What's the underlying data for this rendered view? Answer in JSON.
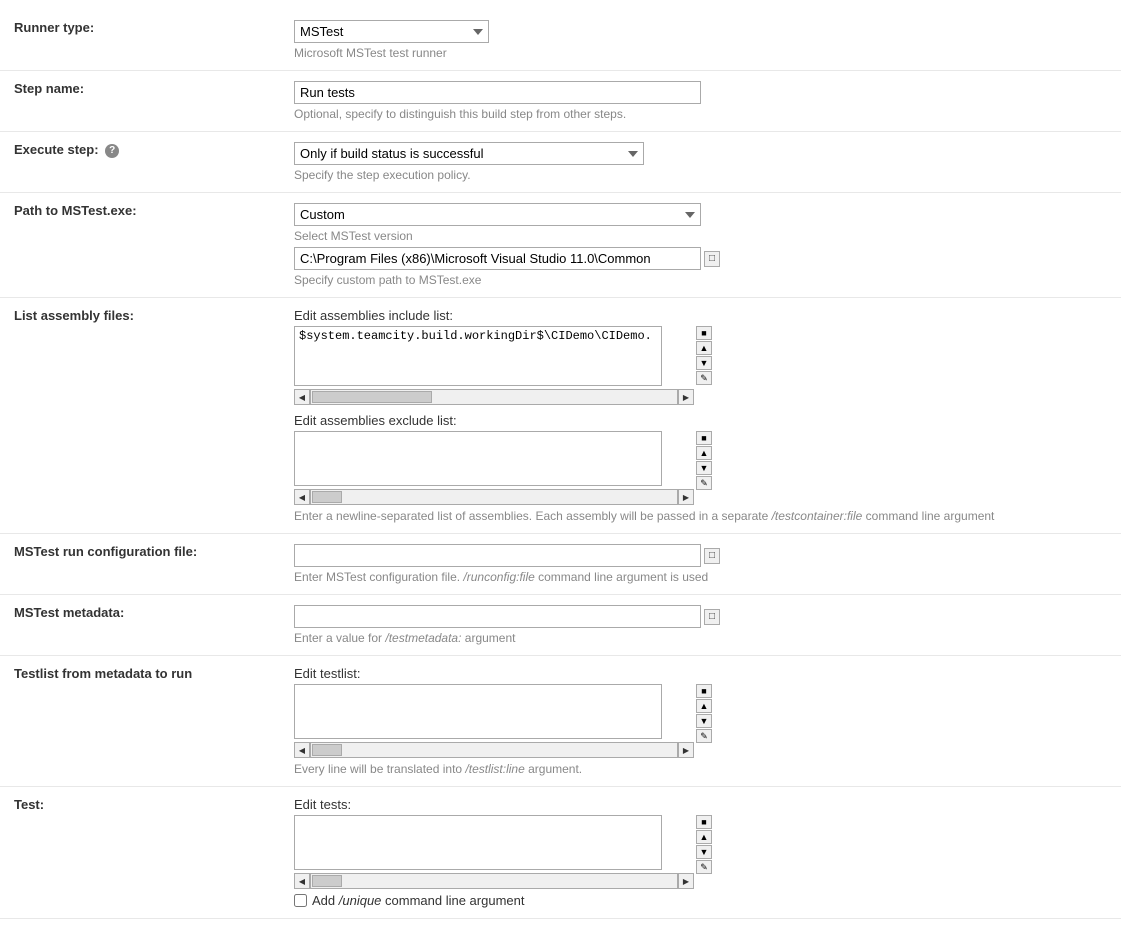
{
  "runner_type": {
    "label": "Runner type:",
    "value": "MSTest",
    "hint": "Microsoft MSTest test runner",
    "options": [
      "MSTest"
    ]
  },
  "step_name": {
    "label": "Step name:",
    "value": "Run tests",
    "hint": "Optional, specify to distinguish this build step from other steps.",
    "placeholder": ""
  },
  "execute_step": {
    "label": "Execute step:",
    "value": "Only if build status is successful",
    "hint": "Specify the step execution policy.",
    "options": [
      "Only if build status is successful"
    ]
  },
  "path_mstest": {
    "label": "Path to MSTest.exe:",
    "select_label": "Select MSTest version",
    "value": "Custom",
    "hint": "Select MSTest version",
    "custom_path_value": "C:\\Program Files (x86)\\Microsoft Visual Studio 11.0\\Common",
    "custom_path_hint": "Specify custom path to MSTest.exe",
    "options": [
      "Custom"
    ]
  },
  "list_assembly": {
    "label": "List assembly files:",
    "include_label": "Edit assemblies include list:",
    "include_value": "$system.teamcity.build.workingDir$\\CIDemo\\CIDemo.",
    "exclude_label": "Edit assemblies exclude list:",
    "exclude_value": "",
    "hint": "Enter a newline-separated list of assemblies. Each assembly will be passed in a separate /testcontainer:file command line argument"
  },
  "mstest_config": {
    "label": "MSTest run configuration file:",
    "value": "",
    "hint": "Enter MSTest configuration file. /runconfig:file command line argument is used"
  },
  "mstest_metadata": {
    "label": "MSTest metadata:",
    "value": "",
    "hint": "Enter a value for /testmetadata: argument"
  },
  "testlist": {
    "label": "Testlist from metadata to run",
    "edit_label": "Edit testlist:",
    "value": "",
    "hint": "Every line will be translated into /testlist:line argument."
  },
  "test": {
    "label": "Test:",
    "edit_label": "Edit tests:",
    "value": "",
    "add_unique_label": "Add /unique command line argument"
  }
}
